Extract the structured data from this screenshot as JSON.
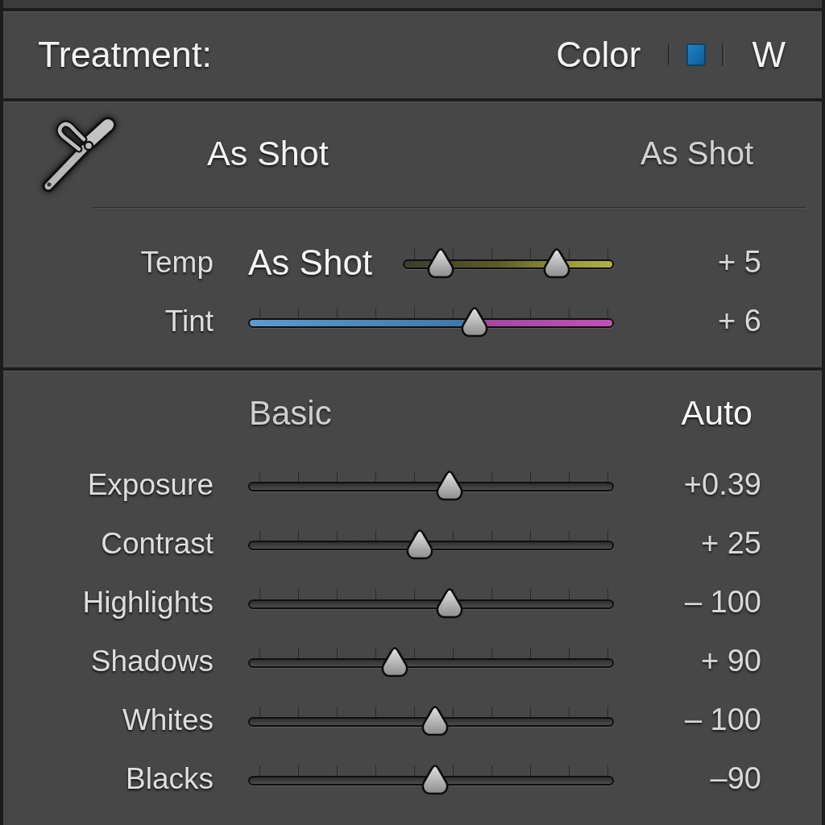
{
  "treatment": {
    "label": "Treatment:",
    "options": [
      {
        "label": "Color"
      },
      {
        "label": "W"
      }
    ]
  },
  "white_balance": {
    "preset": "As Shot",
    "preset_value": "As Shot",
    "rows": [
      {
        "kind": "temperature",
        "label": "Temp",
        "preset": "As Shot",
        "thumbs": [
          {
            "level": 0.18
          },
          {
            "level": 0.73
          }
        ],
        "value": "+ 5"
      },
      {
        "kind": "tint",
        "label": "Tint",
        "level": 0.62,
        "value": "+ 6"
      }
    ]
  },
  "basic": {
    "title": "Basic",
    "auto_button": "Auto",
    "rows": [
      {
        "label": "Exposure",
        "level": 0.55,
        "value": "+0.39"
      },
      {
        "label": "Contrast",
        "level": 0.47,
        "value": "+ 25"
      },
      {
        "label": "Highlights",
        "level": 0.55,
        "value": "– 100"
      },
      {
        "label": "Shadows",
        "level": 0.4,
        "value": "+ 90"
      },
      {
        "label": "Whites",
        "level": 0.51,
        "value": "– 100"
      },
      {
        "label": "Blacks",
        "level": 0.51,
        "value": "–90"
      }
    ]
  }
}
